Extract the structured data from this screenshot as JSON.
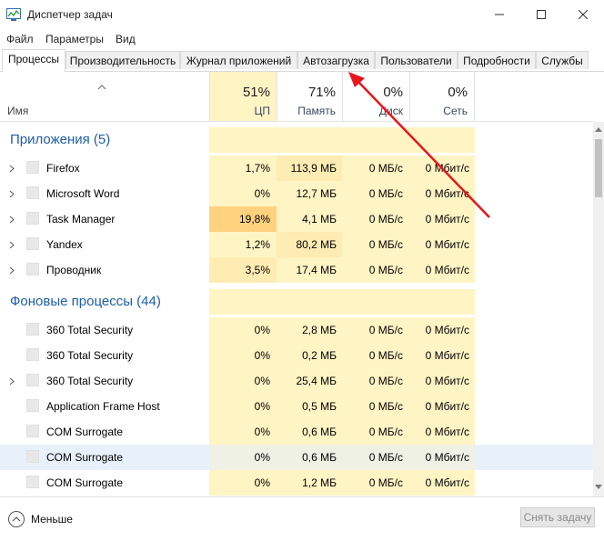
{
  "window": {
    "title": "Диспетчер задач"
  },
  "menu": [
    "Файл",
    "Параметры",
    "Вид"
  ],
  "tabs": [
    {
      "label": "Процессы",
      "active": true
    },
    {
      "label": "Производительность",
      "active": false
    },
    {
      "label": "Журнал приложений",
      "active": false
    },
    {
      "label": "Автозагрузка",
      "active": false
    },
    {
      "label": "Пользователи",
      "active": false
    },
    {
      "label": "Подробности",
      "active": false
    },
    {
      "label": "Службы",
      "active": false
    }
  ],
  "columns": {
    "name": "Имя",
    "cpu": {
      "pct": "51%",
      "label": "ЦП"
    },
    "memory": {
      "pct": "71%",
      "label": "Память"
    },
    "disk": {
      "pct": "0%",
      "label": "Диск"
    },
    "network": {
      "pct": "0%",
      "label": "Сеть"
    }
  },
  "groups": {
    "apps": "Приложения (5)",
    "background": "Фоновые процессы (44)"
  },
  "apps": [
    {
      "name": "Firefox",
      "cpu": "1,7%",
      "mem": "113,9 МБ",
      "disk": "0 МБ/с",
      "net": "0 Мбит/с",
      "expandable": true
    },
    {
      "name": "Microsoft Word",
      "cpu": "0%",
      "mem": "12,7 МБ",
      "disk": "0 МБ/с",
      "net": "0 Мбит/с",
      "expandable": true
    },
    {
      "name": "Task Manager",
      "cpu": "19,8%",
      "mem": "4,1 МБ",
      "disk": "0 МБ/с",
      "net": "0 Мбит/с",
      "expandable": true
    },
    {
      "name": "Yandex",
      "cpu": "1,2%",
      "mem": "80,2 МБ",
      "disk": "0 МБ/с",
      "net": "0 Мбит/с",
      "expandable": true
    },
    {
      "name": "Проводник",
      "cpu": "3,5%",
      "mem": "17,4 МБ",
      "disk": "0 МБ/с",
      "net": "0 Мбит/с",
      "expandable": true
    }
  ],
  "background": [
    {
      "name": "360 Total Security",
      "cpu": "0%",
      "mem": "2,8 МБ",
      "disk": "0 МБ/с",
      "net": "0 Мбит/с",
      "expandable": false
    },
    {
      "name": "360 Total Security",
      "cpu": "0%",
      "mem": "0,2 МБ",
      "disk": "0 МБ/с",
      "net": "0 Мбит/с",
      "expandable": false
    },
    {
      "name": "360 Total Security",
      "cpu": "0%",
      "mem": "25,4 МБ",
      "disk": "0 МБ/с",
      "net": "0 Мбит/с",
      "expandable": true
    },
    {
      "name": "Application Frame Host",
      "cpu": "0%",
      "mem": "0,5 МБ",
      "disk": "0 МБ/с",
      "net": "0 Мбит/с",
      "expandable": false
    },
    {
      "name": "COM Surrogate",
      "cpu": "0%",
      "mem": "0,6 МБ",
      "disk": "0 МБ/с",
      "net": "0 Мбит/с",
      "expandable": false
    },
    {
      "name": "COM Surrogate",
      "cpu": "0%",
      "mem": "0,6 МБ",
      "disk": "0 МБ/с",
      "net": "0 Мбит/с",
      "expandable": false,
      "selected": true
    },
    {
      "name": "COM Surrogate",
      "cpu": "0%",
      "mem": "1,2 МБ",
      "disk": "0 МБ/с",
      "net": "0 Мбит/с",
      "expandable": false
    }
  ],
  "footer": {
    "fewer": "Меньше",
    "end_task": "Снять задачу"
  },
  "colors": {
    "cpu_low": "#fff4c4",
    "cpu_mid": "#ffecb3",
    "cpu_high": "#ffd27f",
    "group_title": "#1d5ea8",
    "selected_row": "#e8f1fb",
    "annotation_arrow": "#e8151b"
  }
}
